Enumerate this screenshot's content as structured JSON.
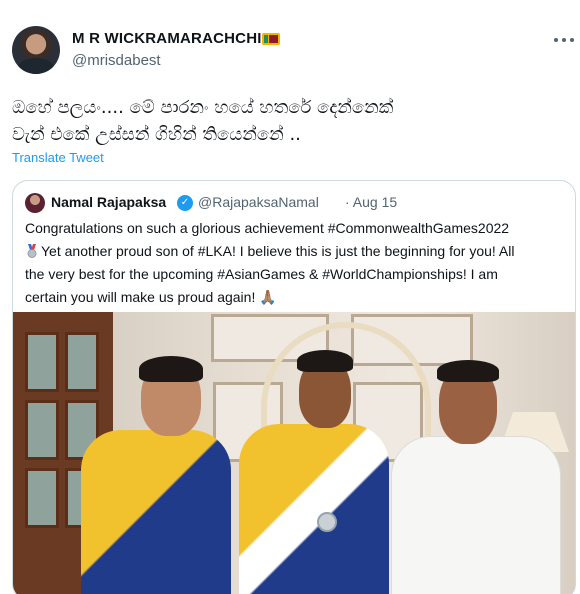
{
  "tweet": {
    "author_name": "M R WICKRAMARACHCHI",
    "author_handle": "@mrisdabest",
    "text_line1": "ඔහේ පලයං.... මේ පාරනං හයේ හතරේ දෙන්නෙක්",
    "text_line2": "වැන් එකේ උස්සන් ගිහින් තියෙන්නේ ..",
    "translate_label": "Translate Tweet"
  },
  "quote": {
    "author_name": "Namal Rajapaksa",
    "author_handle": "@RajapaksaNamal",
    "date": "· Aug 15",
    "line1": "Congratulations on such a glorious achievement #CommonwealthGames2022",
    "line2": "Yet another proud son of #LKA! I believe this is just the beginning for you! All",
    "line3": "the very best for the upcoming #AsianGames & #WorldChampionships! I am",
    "line4": "certain you will make us proud again! 🙏🏽"
  },
  "colors": {
    "link": "#1d9bf0",
    "secondary_text": "#536471",
    "border": "#cfd9de"
  },
  "icons": {
    "more": "more-icon",
    "verified": "verified-badge-icon",
    "medal": "silver-medal-icon",
    "flag": "sri-lanka-flag-icon"
  }
}
